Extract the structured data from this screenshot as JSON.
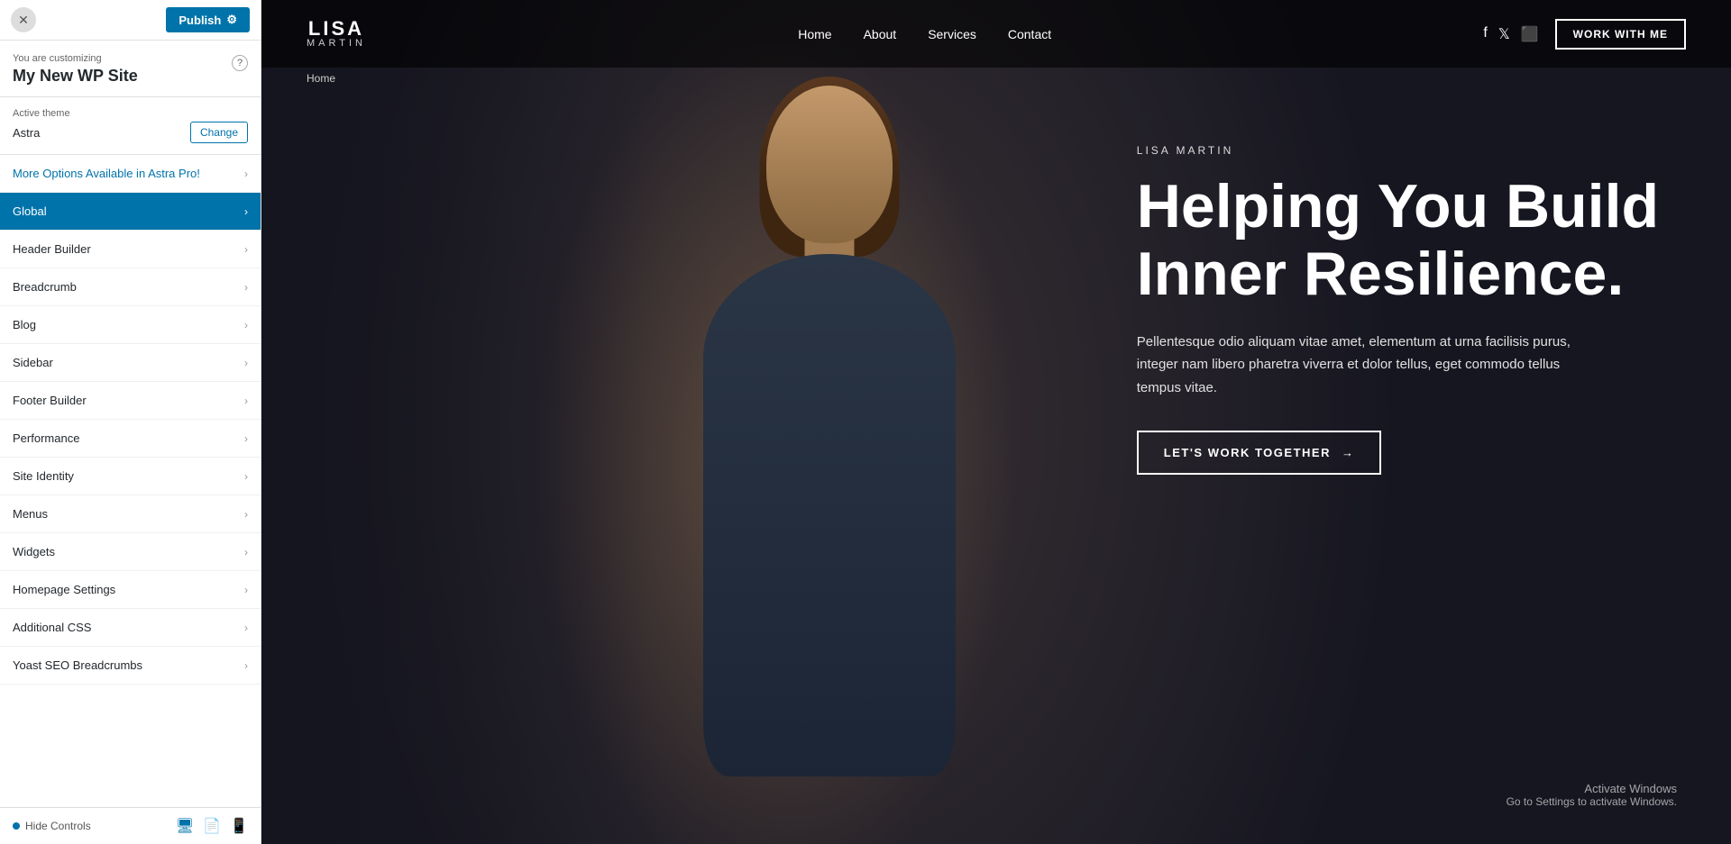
{
  "topbar": {
    "close_label": "✕",
    "publish_label": "Publish",
    "gear_icon": "⚙"
  },
  "customizing": {
    "label": "You are customizing",
    "title": "My New WP Site",
    "help_icon": "?"
  },
  "theme": {
    "label": "Active theme",
    "name": "Astra",
    "change_label": "Change"
  },
  "menu": [
    {
      "id": "astra-pro",
      "label": "More Options Available in Astra Pro!",
      "special": true
    },
    {
      "id": "global",
      "label": "Global",
      "active": true
    },
    {
      "id": "header-builder",
      "label": "Header Builder"
    },
    {
      "id": "breadcrumb",
      "label": "Breadcrumb"
    },
    {
      "id": "blog",
      "label": "Blog"
    },
    {
      "id": "sidebar",
      "label": "Sidebar"
    },
    {
      "id": "footer-builder",
      "label": "Footer Builder"
    },
    {
      "id": "performance",
      "label": "Performance"
    },
    {
      "id": "site-identity",
      "label": "Site Identity"
    },
    {
      "id": "menus",
      "label": "Menus"
    },
    {
      "id": "widgets",
      "label": "Widgets"
    },
    {
      "id": "homepage-settings",
      "label": "Homepage Settings"
    },
    {
      "id": "additional-css",
      "label": "Additional CSS"
    },
    {
      "id": "yoast-seo",
      "label": "Yoast SEO Breadcrumbs"
    }
  ],
  "bottombar": {
    "hide_label": "Hide Controls"
  },
  "site": {
    "logo_main": "LISA",
    "logo_sub": "MARTIN",
    "nav": [
      {
        "label": "Home"
      },
      {
        "label": "About"
      },
      {
        "label": "Services"
      },
      {
        "label": "Contact"
      }
    ],
    "work_with_me": "WORK WITH ME",
    "breadcrumb": "Home",
    "hero": {
      "author": "LISA MARTIN",
      "title_line1": "Helping You Build",
      "title_line2": "Inner Resilience.",
      "description": "Pellentesque odio aliquam vitae amet, elementum at urna facilisis purus, integer nam libero pharetra viverra et dolor tellus, eget commodo tellus tempus vitae.",
      "cta_label": "LET'S WORK TOGETHER",
      "cta_arrow": "→"
    },
    "activate_windows_title": "Activate Windows",
    "activate_windows_sub": "Go to Settings to activate Windows."
  }
}
